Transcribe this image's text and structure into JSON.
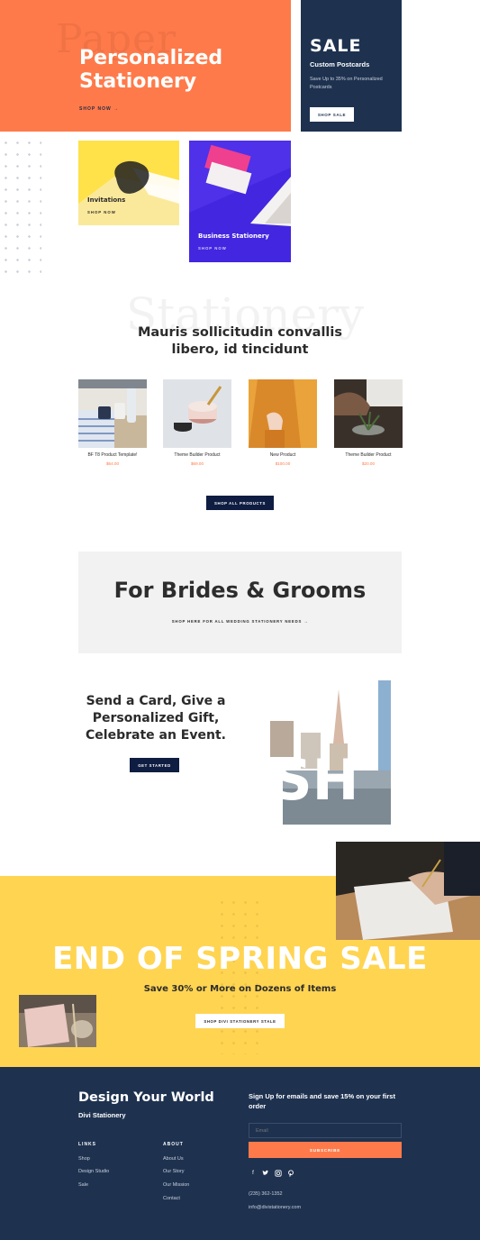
{
  "colors": {
    "orange": "#ff7a4a",
    "navy": "#1e3250",
    "dark_navy": "#0f1d42",
    "yellow": "#ffd451",
    "purple": "#3a1fd0",
    "light_gray": "#f2f2f2"
  },
  "hero": {
    "ghost_text": "Paper",
    "title_line1": "Personalized",
    "title_line2": "Stationery",
    "link": "SHOP NOW →"
  },
  "sale": {
    "title": "SALE",
    "subtitle": "Custom Postcards",
    "description": "Save Up to 35% on Personalized Postcards",
    "button": "SHOP SALE"
  },
  "categories": [
    {
      "label": "Invitations",
      "link": "SHOP NOW"
    },
    {
      "label": "Business Stationery",
      "link": "SHOP NOW"
    }
  ],
  "stationery": {
    "ghost_text": "Stationery",
    "heading_line1": "Mauris sollicitudin convallis",
    "heading_line2": "libero, id tincidunt"
  },
  "products": [
    {
      "name": "BF T8 Product Template!",
      "price": "$64.00"
    },
    {
      "name": "Theme Builder Product",
      "price": "$69.00"
    },
    {
      "name": "New Product",
      "price": "$100.00"
    },
    {
      "name": "Theme Builder Product",
      "price": "$20.00"
    }
  ],
  "shop_all": "SHOP ALL PRODUCTS",
  "brides": {
    "title": "For Brides & Grooms",
    "link": "SHOP HERE FOR ALL WEDDING STATIONERY NEEDS →"
  },
  "card": {
    "line1": "Send a Card, Give a",
    "line2": "Personalized Gift,",
    "line3": "Celebrate an Event.",
    "button": "GET STARTED"
  },
  "spring": {
    "title": "END OF SPRING SALE",
    "subtitle": "Save 30% or More on Dozens of Items",
    "button": "SHOP DIVI STATIONERY STALE"
  },
  "footer": {
    "title": "Design Your World",
    "brand": "Divi Stationery",
    "links_heading": "LINKS",
    "links": [
      "Shop",
      "Design Studio",
      "Sale"
    ],
    "about_heading": "ABOUT",
    "about": [
      "About Us",
      "Our Story",
      "Our Mission",
      "Contact"
    ],
    "signup": "Sign Up for emails and save 15% on your first order",
    "email_placeholder": "Email",
    "subscribe": "SUBSCRIBE",
    "social_icons": [
      "facebook-icon",
      "twitter-icon",
      "instagram-icon",
      "pinterest-icon"
    ],
    "phone": "(235) 362-1352",
    "email": "info@divistationery.com"
  }
}
